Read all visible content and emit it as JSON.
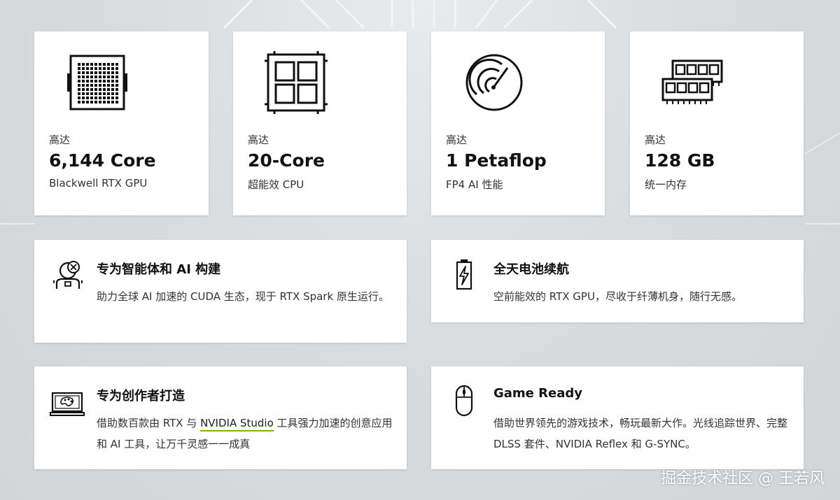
{
  "stats": [
    {
      "prefix": "高达",
      "value": "6,144 Core",
      "subtitle": "Blackwell RTX GPU",
      "icon": "gpu-chip-icon"
    },
    {
      "prefix": "高达",
      "value": "20-Core",
      "subtitle": "超能效 CPU",
      "icon": "cpu-chip-icon"
    },
    {
      "prefix": "高达",
      "value": "1 Petaflop",
      "subtitle": "FP4 AI 性能",
      "icon": "speedometer-icon"
    },
    {
      "prefix": "高达",
      "value": "128 GB",
      "subtitle": "统一内存",
      "icon": "memory-module-icon"
    }
  ],
  "features": [
    {
      "title": "专为智能体和 AI 构建",
      "description": "助力全球 AI 加速的 CUDA 生态，现于 RTX Spark 原生运行。",
      "icon": "ai-agent-icon"
    },
    {
      "title": "全天电池续航",
      "description": "空前能效的 RTX GPU，尽收于纤薄机身，随行无感。",
      "icon": "battery-icon"
    },
    {
      "title": "专为创作者打造",
      "description_pre": "借助数百款由 RTX 与 ",
      "description_link": "NVIDIA Studio",
      "description_post": " 工具强力加速的创意应用和 AI 工具，让万千灵感一一成真",
      "icon": "laptop-palette-icon"
    },
    {
      "title": "Game Ready",
      "description": "借助世界领先的游戏技术，畅玩最新大作。光线追踪世界、完整 DLSS 套件、NVIDIA Reflex 和 G-SYNC。",
      "icon": "mouse-icon"
    }
  ],
  "watermark": "掘金技术社区 @ 王若风",
  "colors": {
    "accent": "#76b900",
    "card": "#ffffff",
    "background": "#d8dbde",
    "text": "#111111"
  }
}
